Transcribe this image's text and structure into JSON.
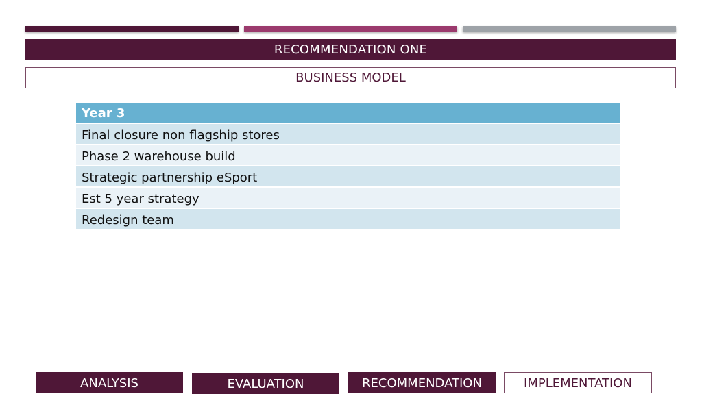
{
  "colors": {
    "primary": "#4f1737",
    "accent_stripe_2": "#9b3a6d",
    "accent_stripe_3": "#9ea3a8",
    "table_header": "#67b1d1",
    "table_row_odd": "#d2e5ee",
    "table_row_even": "#eaf2f7"
  },
  "header": {
    "title": "RECOMMENDATION ONE",
    "subtitle": "BUSINESS MODEL"
  },
  "table": {
    "header": "Year 3",
    "rows": [
      "Final closure non flagship stores",
      "Phase 2 warehouse build",
      "Strategic partnership eSport",
      "Est 5 year strategy",
      "Redesign team"
    ]
  },
  "nav": {
    "tabs": [
      {
        "label": "ANALYSIS",
        "style": "filled"
      },
      {
        "label": "EVALUATION",
        "style": "filled"
      },
      {
        "label": "RECOMMENDATION",
        "style": "filled"
      },
      {
        "label": "IMPLEMENTATION",
        "style": "outlined",
        "active": true
      }
    ]
  }
}
